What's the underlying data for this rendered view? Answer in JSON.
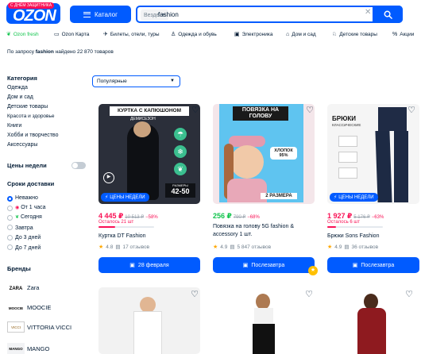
{
  "header": {
    "logo_text": "OZON",
    "logo_badge": "С ДНЁМ ЗАЩИТНИКА",
    "catalog_label": "Каталог",
    "search_scope": "Везде",
    "search_value": "fashion"
  },
  "categories": [
    {
      "label": "Ozon fresh",
      "icon": "leaf-icon"
    },
    {
      "label": "Ozon Карта",
      "icon": "card-icon"
    },
    {
      "label": "Билеты, отели, туры",
      "icon": "plane-icon"
    },
    {
      "label": "Одежда и обувь",
      "icon": "shirt-icon"
    },
    {
      "label": "Электроника",
      "icon": "laptop-icon"
    },
    {
      "label": "Дом и сад",
      "icon": "sofa-icon"
    },
    {
      "label": "Детские товары",
      "icon": "pram-icon"
    },
    {
      "label": "Акции",
      "icon": "percent-icon"
    }
  ],
  "result": {
    "prefix": "По запросу",
    "query": "fashion",
    "suffix": "найдено 22 870 товаров"
  },
  "sidebar": {
    "category_heading": "Категория",
    "categories": [
      "Одежда",
      "Дом и сад",
      "Детские товары",
      "Красота и здоровье",
      "Книги",
      "Хобби и творчество",
      "Аксессуары"
    ],
    "week_prices": "Цены недели",
    "delivery_heading": "Сроки доставки",
    "delivery": [
      "Неважно",
      "От 1 часа",
      "Сегодня",
      "Завтра",
      "До 3 дней",
      "До 7 дней"
    ],
    "brands_heading": "Бренды",
    "brands": [
      {
        "name": "Zara",
        "logo": "ZARA"
      },
      {
        "name": "MOOCIE",
        "logo": "MOOCIE"
      },
      {
        "name": "VITTORIA VICCI",
        "logo": "VICCI"
      },
      {
        "name": "MANGO",
        "logo": "MANGO"
      }
    ]
  },
  "sort": {
    "value": "Популярные"
  },
  "products": [
    {
      "banner": "КУРТКА С КАПЮШОНОМ",
      "banner2": "ДЕМИСЕЗОН",
      "sizes_label": "РАЗМЕРЫ",
      "sizes": "42-50",
      "badge": "ЦЕНЫ НЕДЕЛИ",
      "price": "4 445 ₽",
      "old": "10 513 ₽",
      "disc": "−58%",
      "stock": "Осталось 21 шт",
      "stock_fraction": 0.3,
      "title": "Куртка DT Fashion",
      "rating": "4.8",
      "reviews": "17 отзывов",
      "button": "28 февраля",
      "price_color": "#f91155"
    },
    {
      "banner": "ПОВЯЗКА НА ГОЛОВУ",
      "callout": "ХЛОПОК 95%",
      "sizes": "2 РАЗМЕРА",
      "price": "256 ₽",
      "old": "790 ₽",
      "disc": "−68%",
      "title": "Повязка на голову 5G fashion & accessory 1 шт.",
      "rating": "4.9",
      "reviews": "5 847 отзывов",
      "button": "Послезавтра",
      "price_color": "#10c44c"
    },
    {
      "banner": "БРЮКИ",
      "banner2": "КЛАССИЧЕСКИЕ",
      "badge": "ЦЕНЫ НЕДЕЛИ",
      "price": "1 927 ₽",
      "old": "5 176 ₽",
      "disc": "−63%",
      "stock": "Осталось 6 шт",
      "stock_fraction": 0.15,
      "title": "Брюки Sons Fashion",
      "rating": "4.9",
      "reviews": "36 отзывов",
      "button": "Послезавтра",
      "price_color": "#f91155"
    }
  ]
}
